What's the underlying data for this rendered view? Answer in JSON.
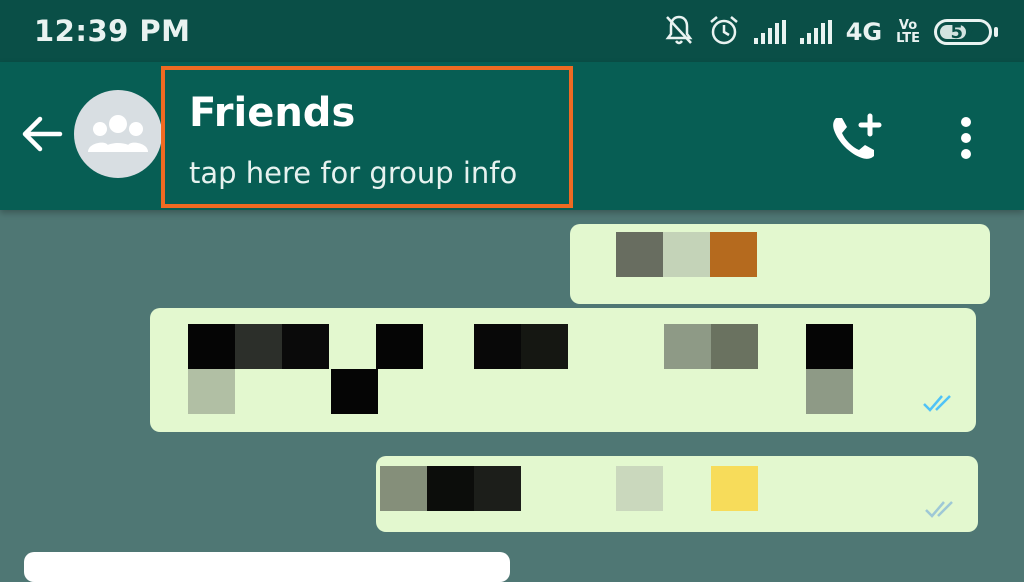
{
  "status_bar": {
    "time": "12:39 PM",
    "network": "4G",
    "volte_top": "Vo",
    "volte_bottom": "LTE",
    "battery": "57",
    "icons": [
      "mute-notifications-icon",
      "alarm-icon",
      "signal-icon",
      "signal-icon",
      "volte-icon",
      "battery-icon"
    ]
  },
  "header": {
    "title": "Friends",
    "subtitle": "tap here for group info",
    "icons": [
      "back-arrow-icon",
      "group-avatar-icon",
      "add-call-icon",
      "more-options-icon"
    ]
  },
  "colors": {
    "status_bar": "#0a4f47",
    "app_bar": "#075e54",
    "chat_bg": "#4f7774",
    "outgoing_bubble": "#e3f8cf",
    "highlight": "#ef6a22",
    "read_tick": "#4fc3f7"
  }
}
